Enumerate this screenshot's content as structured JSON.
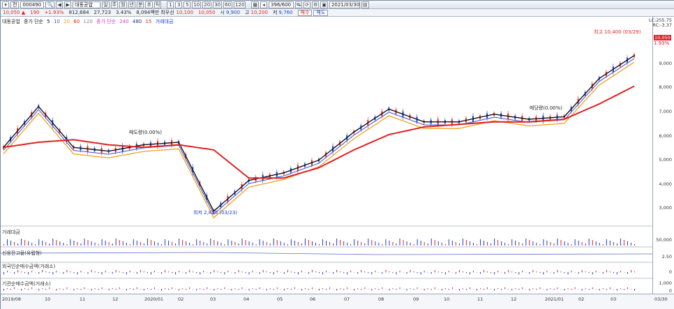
{
  "toolbar": {
    "market": "전",
    "code": "000490",
    "name": "대동공업",
    "counter": "396/600",
    "date": "2021/03/30",
    "period_buttons": [
      "일",
      "주",
      "월",
      "년",
      "분",
      "초",
      "틱"
    ],
    "interval_buttons": [
      "1",
      "3",
      "5",
      "10",
      "20",
      "30",
      "60",
      "120"
    ]
  },
  "quote": {
    "price": "10,050 ▲",
    "change": "190",
    "change_pct": "+1.93%",
    "volume": "812,684",
    "vol_change": "27,723",
    "turnover_pct": "3.43%",
    "amount": "8,094백만",
    "prev_label": "최우선",
    "prev": "10,100",
    "ask": "10,050",
    "open_label": "시",
    "open": "9,900",
    "high_label": "고",
    "high": "10,200",
    "low_label": "저",
    "low": "9,760",
    "buy_label": "매수",
    "sell_label": "매도"
  },
  "legend": {
    "name": "대동공업",
    "ma_label": "종가 단순",
    "ma_periods": [
      "5",
      "10",
      "20",
      "60",
      "120"
    ],
    "ma2_label": "종가 단순",
    "ma2_periods": [
      "240",
      "480",
      "15"
    ],
    "vol_label": "거래대금"
  },
  "panes": {
    "p1": "거래대금",
    "p2": "신용잔고율(유럽형)",
    "p3": "외국인순매수금액(거래소)",
    "p4": "기관순매수금액(거래소)"
  },
  "annotations": {
    "high": "최고 10,400 (03/29)",
    "low": "최저 2,825 (03/23)",
    "shift1": "매도량(0.00%)",
    "shift2": "매당량(0.00%)",
    "lc": "LC:255.75",
    "rc": "RC:-3.37",
    "cur_price": "10,050",
    "cur_pct": "1.93%"
  },
  "y_axis_labels": [
    "9,000",
    "8,000",
    "7,000",
    "6,000",
    "5,000",
    "4,000",
    "3,000"
  ],
  "pane_y_labels": [
    "50,000",
    "2.50",
    "0",
    "1,000",
    "0"
  ],
  "x_axis_labels": [
    "2019/08",
    "10",
    "11",
    "12",
    "2020/01",
    "02",
    "03",
    "04",
    "05",
    "06",
    "07",
    "08",
    "09",
    "10",
    "11",
    "12",
    "2021/01",
    "02",
    "03",
    "03/30"
  ],
  "colors": {
    "up": "#e0201f",
    "down": "#1f3cc8",
    "ma5": "#111111",
    "ma10": "#3a4fd6",
    "ma20": "#f0a020",
    "ma60": "#e0201f",
    "ma120": "#888888",
    "ma240": "#d040c0",
    "ma480": "#20308a"
  },
  "chart_data": {
    "type": "candlestick",
    "x": [
      "2019/08",
      "10",
      "11",
      "12",
      "2020/01",
      "02",
      "03",
      "04",
      "05",
      "06",
      "07",
      "08",
      "09",
      "10",
      "11",
      "12",
      "2021/01",
      "02",
      "03"
    ],
    "series": [
      {
        "name": "5",
        "values": [
          5700,
          7300,
          5700,
          5550,
          5800,
          5900,
          3200,
          4400,
          4700,
          5200,
          6300,
          7200,
          6700,
          6700,
          7000,
          6800,
          6900,
          8400,
          9300
        ]
      },
      {
        "name": "60",
        "values": [
          5700,
          5900,
          6000,
          5800,
          5700,
          5800,
          5600,
          4500,
          4500,
          4900,
          5600,
          6200,
          6500,
          6600,
          6700,
          6700,
          6800,
          7400,
          8100
        ]
      }
    ],
    "ylim": [
      2700,
      10600
    ]
  }
}
